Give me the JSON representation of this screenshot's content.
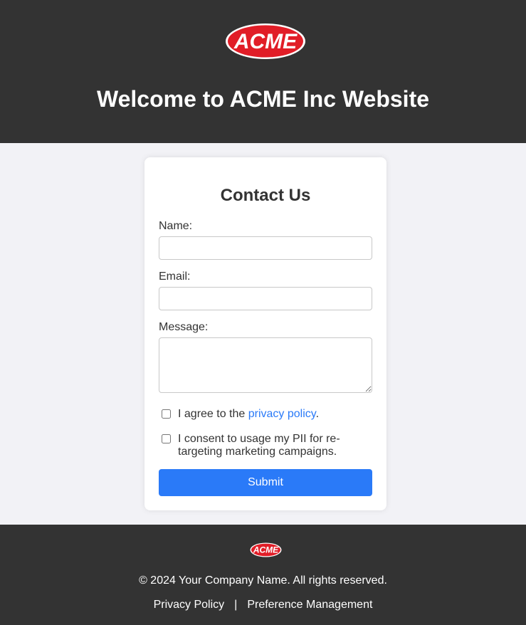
{
  "header": {
    "logo_text": "ACME",
    "title": "Welcome to ACME Inc Website"
  },
  "form": {
    "title": "Contact Us",
    "name_label": "Name:",
    "email_label": "Email:",
    "message_label": "Message:",
    "name_value": "",
    "email_value": "",
    "message_value": "",
    "privacy_prefix": "I agree to the",
    "privacy_link": "privacy policy",
    "privacy_suffix": ".",
    "consent_text": "I consent to usage my PII for re-targeting marketing campaigns.",
    "submit_label": "Submit"
  },
  "footer": {
    "logo_text": "ACME",
    "copyright": "© 2024 Your Company Name. All rights reserved.",
    "privacy_policy_link": "Privacy Policy",
    "separator": "|",
    "preference_link": "Preference Management"
  },
  "colors": {
    "dark_band": "#333333",
    "page_bg": "#f2f2f6",
    "accent_blue": "#2a7af8",
    "logo_red": "#e11d27"
  }
}
